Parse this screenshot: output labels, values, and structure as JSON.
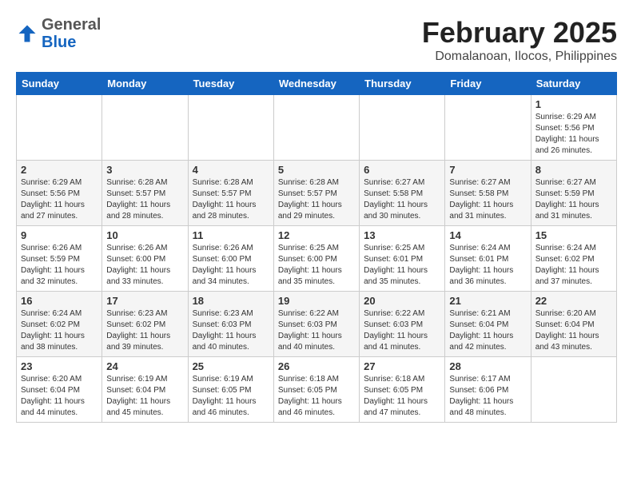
{
  "header": {
    "logo_general": "General",
    "logo_blue": "Blue",
    "main_title": "February 2025",
    "subtitle": "Domalanoan, Ilocos, Philippines"
  },
  "weekdays": [
    "Sunday",
    "Monday",
    "Tuesday",
    "Wednesday",
    "Thursday",
    "Friday",
    "Saturday"
  ],
  "weeks": [
    [
      {
        "day": "",
        "info": ""
      },
      {
        "day": "",
        "info": ""
      },
      {
        "day": "",
        "info": ""
      },
      {
        "day": "",
        "info": ""
      },
      {
        "day": "",
        "info": ""
      },
      {
        "day": "",
        "info": ""
      },
      {
        "day": "1",
        "info": "Sunrise: 6:29 AM\nSunset: 5:56 PM\nDaylight: 11 hours and 26 minutes."
      }
    ],
    [
      {
        "day": "2",
        "info": "Sunrise: 6:29 AM\nSunset: 5:56 PM\nDaylight: 11 hours and 27 minutes."
      },
      {
        "day": "3",
        "info": "Sunrise: 6:28 AM\nSunset: 5:57 PM\nDaylight: 11 hours and 28 minutes."
      },
      {
        "day": "4",
        "info": "Sunrise: 6:28 AM\nSunset: 5:57 PM\nDaylight: 11 hours and 28 minutes."
      },
      {
        "day": "5",
        "info": "Sunrise: 6:28 AM\nSunset: 5:57 PM\nDaylight: 11 hours and 29 minutes."
      },
      {
        "day": "6",
        "info": "Sunrise: 6:27 AM\nSunset: 5:58 PM\nDaylight: 11 hours and 30 minutes."
      },
      {
        "day": "7",
        "info": "Sunrise: 6:27 AM\nSunset: 5:58 PM\nDaylight: 11 hours and 31 minutes."
      },
      {
        "day": "8",
        "info": "Sunrise: 6:27 AM\nSunset: 5:59 PM\nDaylight: 11 hours and 31 minutes."
      }
    ],
    [
      {
        "day": "9",
        "info": "Sunrise: 6:26 AM\nSunset: 5:59 PM\nDaylight: 11 hours and 32 minutes."
      },
      {
        "day": "10",
        "info": "Sunrise: 6:26 AM\nSunset: 6:00 PM\nDaylight: 11 hours and 33 minutes."
      },
      {
        "day": "11",
        "info": "Sunrise: 6:26 AM\nSunset: 6:00 PM\nDaylight: 11 hours and 34 minutes."
      },
      {
        "day": "12",
        "info": "Sunrise: 6:25 AM\nSunset: 6:00 PM\nDaylight: 11 hours and 35 minutes."
      },
      {
        "day": "13",
        "info": "Sunrise: 6:25 AM\nSunset: 6:01 PM\nDaylight: 11 hours and 35 minutes."
      },
      {
        "day": "14",
        "info": "Sunrise: 6:24 AM\nSunset: 6:01 PM\nDaylight: 11 hours and 36 minutes."
      },
      {
        "day": "15",
        "info": "Sunrise: 6:24 AM\nSunset: 6:02 PM\nDaylight: 11 hours and 37 minutes."
      }
    ],
    [
      {
        "day": "16",
        "info": "Sunrise: 6:24 AM\nSunset: 6:02 PM\nDaylight: 11 hours and 38 minutes."
      },
      {
        "day": "17",
        "info": "Sunrise: 6:23 AM\nSunset: 6:02 PM\nDaylight: 11 hours and 39 minutes."
      },
      {
        "day": "18",
        "info": "Sunrise: 6:23 AM\nSunset: 6:03 PM\nDaylight: 11 hours and 40 minutes."
      },
      {
        "day": "19",
        "info": "Sunrise: 6:22 AM\nSunset: 6:03 PM\nDaylight: 11 hours and 40 minutes."
      },
      {
        "day": "20",
        "info": "Sunrise: 6:22 AM\nSunset: 6:03 PM\nDaylight: 11 hours and 41 minutes."
      },
      {
        "day": "21",
        "info": "Sunrise: 6:21 AM\nSunset: 6:04 PM\nDaylight: 11 hours and 42 minutes."
      },
      {
        "day": "22",
        "info": "Sunrise: 6:20 AM\nSunset: 6:04 PM\nDaylight: 11 hours and 43 minutes."
      }
    ],
    [
      {
        "day": "23",
        "info": "Sunrise: 6:20 AM\nSunset: 6:04 PM\nDaylight: 11 hours and 44 minutes."
      },
      {
        "day": "24",
        "info": "Sunrise: 6:19 AM\nSunset: 6:04 PM\nDaylight: 11 hours and 45 minutes."
      },
      {
        "day": "25",
        "info": "Sunrise: 6:19 AM\nSunset: 6:05 PM\nDaylight: 11 hours and 46 minutes."
      },
      {
        "day": "26",
        "info": "Sunrise: 6:18 AM\nSunset: 6:05 PM\nDaylight: 11 hours and 46 minutes."
      },
      {
        "day": "27",
        "info": "Sunrise: 6:18 AM\nSunset: 6:05 PM\nDaylight: 11 hours and 47 minutes."
      },
      {
        "day": "28",
        "info": "Sunrise: 6:17 AM\nSunset: 6:06 PM\nDaylight: 11 hours and 48 minutes."
      },
      {
        "day": "",
        "info": ""
      }
    ]
  ]
}
